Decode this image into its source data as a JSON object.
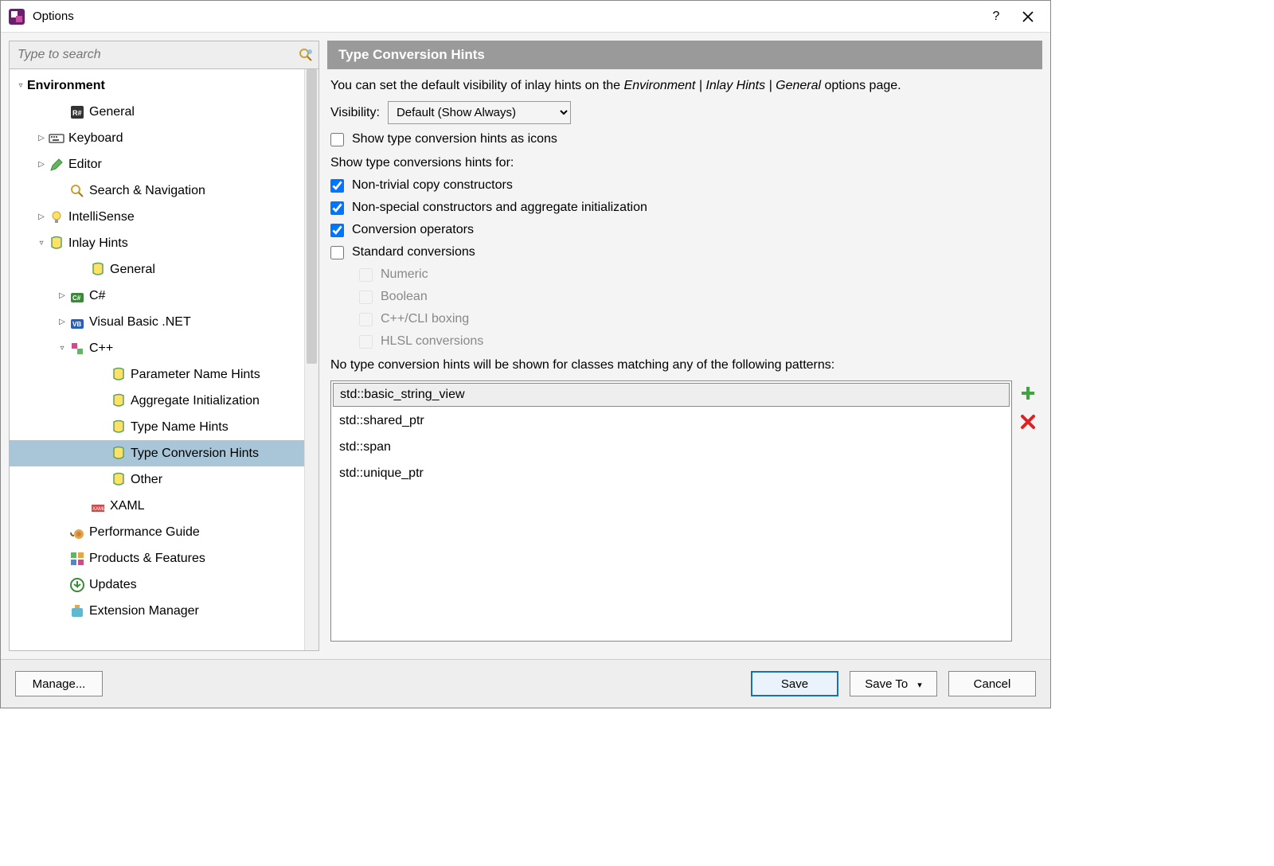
{
  "window": {
    "title": "Options"
  },
  "search": {
    "placeholder": "Type to search"
  },
  "tree": {
    "root": "Environment",
    "items": [
      {
        "label": "General",
        "indent": 2,
        "exp": "",
        "icon": "rsharp"
      },
      {
        "label": "Keyboard",
        "indent": 1,
        "exp": "▷",
        "icon": "keyboard"
      },
      {
        "label": "Editor",
        "indent": 1,
        "exp": "▷",
        "icon": "pencil"
      },
      {
        "label": "Search & Navigation",
        "indent": 2,
        "exp": "",
        "icon": "magnifier"
      },
      {
        "label": "IntelliSense",
        "indent": 1,
        "exp": "▷",
        "icon": "bulb"
      },
      {
        "label": "Inlay Hints",
        "indent": 1,
        "exp": "▿",
        "icon": "hint"
      },
      {
        "label": "General",
        "indent": 3,
        "exp": "",
        "icon": "hint"
      },
      {
        "label": "C#",
        "indent": 2,
        "exp": "▷",
        "icon": "cs"
      },
      {
        "label": "Visual Basic .NET",
        "indent": 2,
        "exp": "▷",
        "icon": "vb"
      },
      {
        "label": "C++",
        "indent": 2,
        "exp": "▿",
        "icon": "cpp"
      },
      {
        "label": "Parameter Name Hints",
        "indent": 4,
        "exp": "",
        "icon": "hint"
      },
      {
        "label": "Aggregate Initialization",
        "indent": 4,
        "exp": "",
        "icon": "hint"
      },
      {
        "label": "Type Name Hints",
        "indent": 4,
        "exp": "",
        "icon": "hint"
      },
      {
        "label": "Type Conversion Hints",
        "indent": 4,
        "exp": "",
        "icon": "hint-sel",
        "selected": true
      },
      {
        "label": "Other",
        "indent": 4,
        "exp": "",
        "icon": "hint"
      },
      {
        "label": "XAML",
        "indent": 3,
        "exp": "",
        "icon": "xaml"
      },
      {
        "label": "Performance Guide",
        "indent": 2,
        "exp": "",
        "icon": "snail"
      },
      {
        "label": "Products & Features",
        "indent": 2,
        "exp": "",
        "icon": "grid"
      },
      {
        "label": "Updates",
        "indent": 2,
        "exp": "",
        "icon": "update"
      },
      {
        "label": "Extension Manager",
        "indent": 2,
        "exp": "",
        "icon": "ext"
      }
    ]
  },
  "content": {
    "header": "Type Conversion Hints",
    "intro_a": "You can set the default visibility of inlay hints on the ",
    "intro_crumb": "Environment | Inlay Hints | General",
    "intro_b": " options page.",
    "visibility_label": "Visibility:",
    "visibility_value": "Default (Show Always)",
    "show_as_icons": "Show type conversion hints as icons",
    "show_for_label": "Show type conversions hints for:",
    "checks": [
      {
        "label": "Non-trivial copy constructors",
        "checked": true
      },
      {
        "label": "Non-special constructors and aggregate initialization",
        "checked": true
      },
      {
        "label": "Conversion operators",
        "checked": true
      },
      {
        "label": "Standard conversions",
        "checked": false
      }
    ],
    "sub_checks": [
      {
        "label": "Numeric"
      },
      {
        "label": "Boolean"
      },
      {
        "label": "C++/CLI boxing"
      },
      {
        "label": "HLSL conversions"
      }
    ],
    "patterns_label": "No type conversion hints will be shown for classes matching any of the following patterns:",
    "patterns": [
      "std::basic_string_view",
      "std::shared_ptr",
      "std::span",
      "std::unique_ptr"
    ]
  },
  "footer": {
    "manage": "Manage...",
    "save": "Save",
    "save_to": "Save To",
    "cancel": "Cancel"
  }
}
